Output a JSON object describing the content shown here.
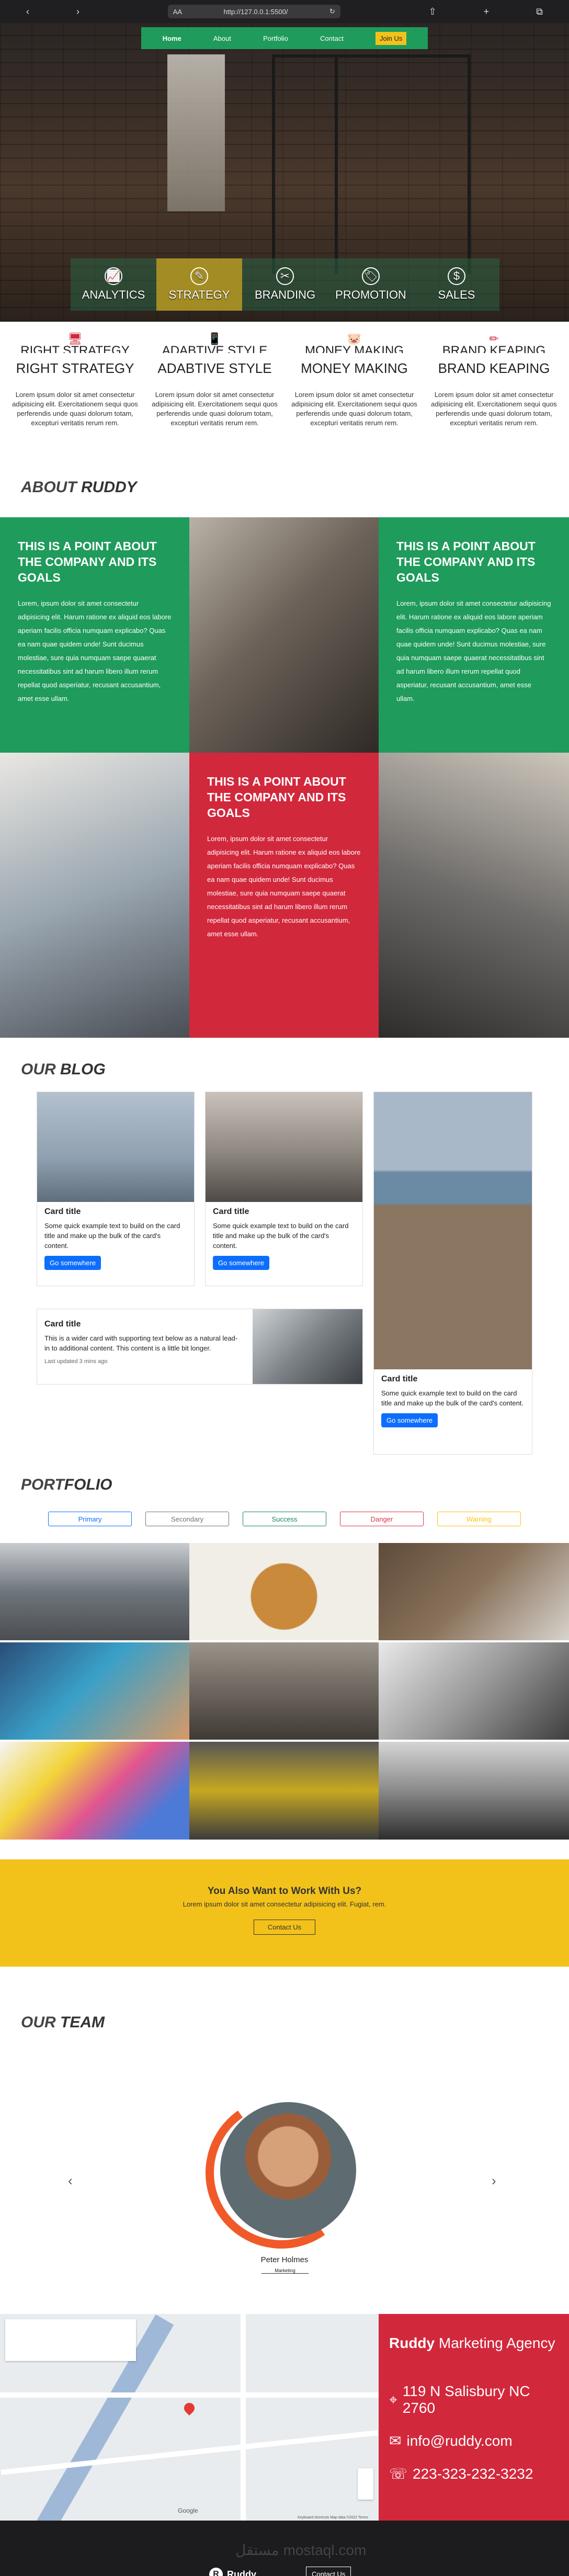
{
  "browser": {
    "back_icon": "‹",
    "forward_icon": "›",
    "aa": "AA",
    "url": "http://127.0.0.1:5500/",
    "reload_icon": "↻",
    "share_icon": "⇧",
    "new_tab_icon": "+",
    "tabs_icon": "⧉"
  },
  "nav": {
    "items": [
      "Home",
      "About",
      "Portfolio",
      "Contact"
    ],
    "join": "Join Us"
  },
  "hero": {
    "features": [
      {
        "label": "ANALYTICS",
        "icon": "📈"
      },
      {
        "label": "STRATEGY",
        "icon": "✎"
      },
      {
        "label": "BRANDING",
        "icon": "✂"
      },
      {
        "label": "PROMOTION",
        "icon": "🏷"
      },
      {
        "label": "SALES",
        "icon": "$"
      }
    ]
  },
  "pillars": [
    {
      "ghost": "RIGHT STRATEGY",
      "title": "RIGHT STRATEGY",
      "icon": "🖥",
      "text": "Lorem ipsum dolor sit amet consectetur adipisicing elit. Exercitationem sequi quos perferendis unde quasi dolorum totam, excepturi veritatis rerum rem."
    },
    {
      "ghost": "ADABTIVE STYLE",
      "title": "ADABTIVE STYLE",
      "icon": "📱",
      "text": "Lorem ipsum dolor sit amet consectetur adipisicing elit. Exercitationem sequi quos perferendis unde quasi dolorum totam, excepturi veritatis rerum rem."
    },
    {
      "ghost": "MONEY MAKING",
      "title": "MONEY MAKING",
      "icon": "🐷",
      "text": "Lorem ipsum dolor sit amet consectetur adipisicing elit. Exercitationem sequi quos perferendis unde quasi dolorum totam, excepturi veritatis rerum rem."
    },
    {
      "ghost": "BRAND KEAPING",
      "title": "BRAND KEAPING",
      "icon": "✏",
      "text": "Lorem ipsum dolor sit amet consectetur adipisicing elit. Exercitationem sequi quos perferendis unde quasi dolorum totam, excepturi veritatis rerum rem."
    }
  ],
  "about": {
    "title_a": "ABOUT ",
    "title_b": "RUDDY",
    "tile_heading": "THIS IS A POINT ABOUT THE COMPANY AND ITS GOALS",
    "tile_text": "Lorem, ipsum dolor sit amet consectetur adipisicing elit. Harum ratione ex aliquid eos labore aperiam facilis officia numquam explicabo? Quas ea nam quae quidem unde! Sunt ducimus molestiae, sure quia numquam saepe quaerat necessitatibus sint ad harum libero illum rerum repellat quod asperiatur, recusant accusantium, amet esse ullam."
  },
  "blog": {
    "title_a": "OUR ",
    "title_b": "BLOG",
    "cards": [
      {
        "title": "Card title",
        "text": "Some quick example text to build on the card title and make up the bulk of the card's content.",
        "button": "Go somewhere"
      },
      {
        "title": "Card title",
        "text": "Some quick example text to build on the card title and make up the bulk of the card's content.",
        "button": "Go somewhere"
      },
      {
        "title": "Card title",
        "text": "Some quick example text to build on the card title and make up the bulk of the card's content.",
        "button": "Go somewhere"
      }
    ],
    "wide": {
      "title": "Card title",
      "text": "This is a wider card with supporting text below as a natural lead-in to additional content. This content is a little bit longer.",
      "updated": "Last updated 3 mins ago"
    }
  },
  "portfolio": {
    "title_a": "PORT",
    "title_b": "FOLIO",
    "filters": [
      {
        "label": "Primary",
        "color": "#0d6efd"
      },
      {
        "label": "Secondary",
        "color": "#6c757d"
      },
      {
        "label": "Success",
        "color": "#198754"
      },
      {
        "label": "Danger",
        "color": "#dc3545"
      },
      {
        "label": "Warning",
        "color": "#ffc107"
      }
    ]
  },
  "cta": {
    "title": "You Also Want to Work With Us?",
    "text": "Lorem ipsum dolor sit amet consectetur adipisicing elit. Fugiat, rem.",
    "button": "Contact Us"
  },
  "team": {
    "title_a": "OUR ",
    "title_b": "TEAM",
    "name": "Peter Holmes",
    "role": "Marketing",
    "prev": "‹",
    "next": "›"
  },
  "contact": {
    "brand": "Ruddy",
    "tagline": "Marketing Agency",
    "address": "119 N Salisbury NC 2760",
    "email": "info@ruddy.com",
    "phone": "223-323-232-3232",
    "map_labels": [
      "Google",
      "Keyboard shortcuts  Map data ©2022  Terms"
    ]
  },
  "footer": {
    "logo_letter": "R",
    "brand": "Ruddy",
    "button": "Contact Us",
    "watermark": "مستقل mostaql.com"
  },
  "colors": {
    "green": "#1f9b5b",
    "red": "#d2283c",
    "yellow": "#f3c21a",
    "dark": "#1c1c1e"
  }
}
